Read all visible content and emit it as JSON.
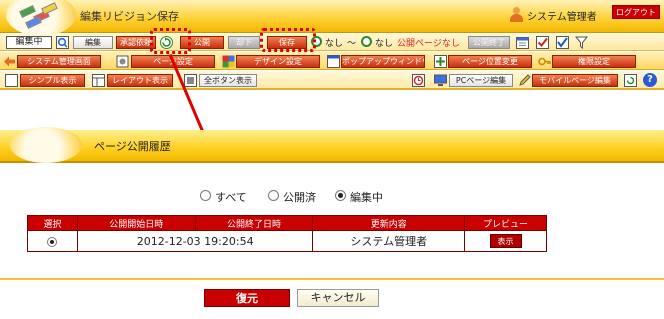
{
  "app": {
    "title": "編集リビジョン保存",
    "user": "システム管理者",
    "logout": "ログアウト"
  },
  "toolbar1": {
    "edit_status": "編集中",
    "edit_btn": "編集",
    "approve_btn": "承認依頼",
    "publish_btn": "公開",
    "withdraw_btn": "却下",
    "save_btn": "保存",
    "from_label": "なし",
    "tilde": "〜",
    "to_label": "なし",
    "publish_period": "公開ページなし",
    "publish_end_btn": "公開終了"
  },
  "toolbar2": {
    "system_admin": "システム管理画面",
    "page_settings": "ページ設定",
    "design_settings": "デザイン設定",
    "popup_window": "ポップアップウィンドウ",
    "page_position": "ページ位置変更",
    "permission": "権限設定"
  },
  "toolbar3": {
    "simple_view": "シンプル表示",
    "layout_view": "レイアウト表示",
    "all_buttons": "全ボタン表示",
    "pc_edit": "PCページ編集",
    "mobile_edit": "モバイルページ編集",
    "help_icon": "?"
  },
  "dialog": {
    "title": "ページ公開履歴",
    "filters": [
      {
        "label": "すべて",
        "checked": false
      },
      {
        "label": "公開済",
        "checked": false
      },
      {
        "label": "編集中",
        "checked": true
      }
    ],
    "columns": [
      "選択",
      "公開開始日時",
      "公開終了日時",
      "更新内容",
      "プレビュー"
    ],
    "rows": [
      {
        "selected": true,
        "start": "2012-12-03 19:20:54",
        "end": "",
        "content": "システム管理者",
        "preview": "表示"
      }
    ],
    "restore": "復元",
    "cancel": "キャンセル"
  },
  "colors": {
    "accent": "#ffd020",
    "table_header": "#c80000",
    "callout": "#e00000"
  }
}
